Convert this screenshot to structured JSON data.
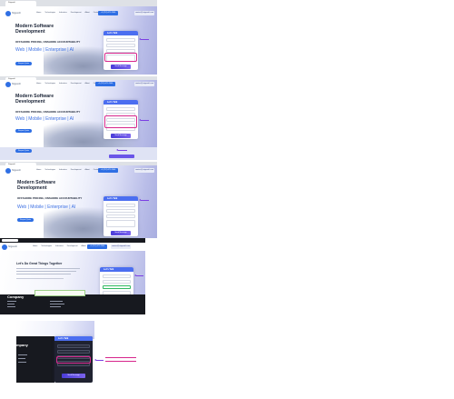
{
  "browser": {
    "tab_title": "Stigasoft"
  },
  "site": {
    "brand": "Stigasoft",
    "nav": [
      "Home",
      "Technologies",
      "Industries",
      "Development",
      "About",
      "Contact"
    ],
    "call_button": "+1 (212) 671-2006",
    "email_button": "contact@stigasoft.com"
  },
  "hero": {
    "title_line1": "Modern Software",
    "title_line2": "Development",
    "tagline": "OFFSHORE PRICING, ONSHORE ACCOUNTABILITY",
    "services": "Web | Mobile | Enterprise | AI",
    "cta": "Request Quote"
  },
  "form": {
    "title": "Let's Talk",
    "submit": "Send Message"
  },
  "section": {
    "heading": "Let's Do Great Things Together",
    "company": "Company",
    "company_trunc": "mpany"
  },
  "colors": {
    "accent": "#2f6fe4",
    "highlight": "#d7268c",
    "arrow": "#7b3fe4"
  }
}
